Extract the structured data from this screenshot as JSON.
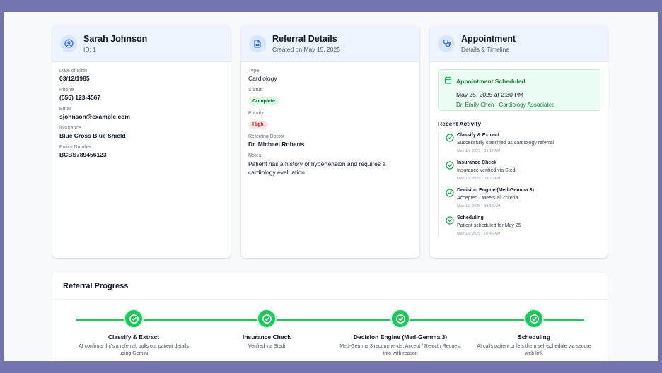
{
  "patient": {
    "name": "Sarah Johnson",
    "id_line": "ID: 1",
    "icon": "user-circle-icon",
    "fields": [
      {
        "label": "Date of Birth",
        "value": "03/12/1985"
      },
      {
        "label": "Phone",
        "value": "(555) 123-4567"
      },
      {
        "label": "Email",
        "value": "sjohnson@example.com"
      },
      {
        "label": "Insurance",
        "value": "Blue Cross Blue Shield"
      },
      {
        "label": "Policy Number",
        "value": "BCBS789456123"
      }
    ]
  },
  "referral": {
    "title": "Referral Details",
    "subtitle": "Created on May 15, 2025",
    "icon": "document-icon",
    "type_label": "Type",
    "type_value": "Cardiology",
    "status_label": "Status",
    "status_value": "Complete",
    "priority_label": "Priority",
    "priority_value": "High",
    "doctor_label": "Referring Doctor",
    "doctor_value": "Dr. Michael Roberts",
    "notes_label": "Notes",
    "notes_value": "Patient has a history of hypertension and requires a cardiology evaluation."
  },
  "appointment": {
    "title": "Appointment",
    "subtitle": "Details & Timeline",
    "icon": "stethoscope-icon",
    "scheduled_label": "Appointment Scheduled",
    "datetime": "May 25, 2025 at 2:30 PM",
    "doctor": "Dr. Emily Chen - Cardiology Associates",
    "recent_title": "Recent Activity",
    "activity": [
      {
        "name": "Classify & Extract",
        "desc": "Successfully classified as cardiology referral",
        "time": "May 15, 2025 - 09:12 AM"
      },
      {
        "name": "Insurance Check",
        "desc": "Insurance verified via Stedi",
        "time": "May 15, 2025 - 09:15 AM"
      },
      {
        "name": "Decision Engine (Med-Gemma 3)",
        "desc": "Accepted - Meets all criteria",
        "time": "May 15, 2025 - 09:18 AM"
      },
      {
        "name": "Scheduling",
        "desc": "Patient scheduled for May 25",
        "time": "May 15, 2025 - 10:45 AM"
      }
    ]
  },
  "progress": {
    "title": "Referral Progress",
    "steps": [
      {
        "name": "Classify & Extract",
        "desc": "AI confirms if it's a referral, pulls out patient details using Gemini"
      },
      {
        "name": "Insurance Check",
        "desc": "Verified via Stedi"
      },
      {
        "name": "Decision Engine (Med-Gemma 3)",
        "desc": "Med-Gemma 3 recommends: Accept / Reject / Request Info with reason"
      },
      {
        "name": "Scheduling",
        "desc": "AI calls patient or lets them self-schedule via secure web link"
      }
    ]
  },
  "colors": {
    "accent": "#2563eb",
    "success": "#22c55e",
    "frame_bg": "#7274b0"
  }
}
